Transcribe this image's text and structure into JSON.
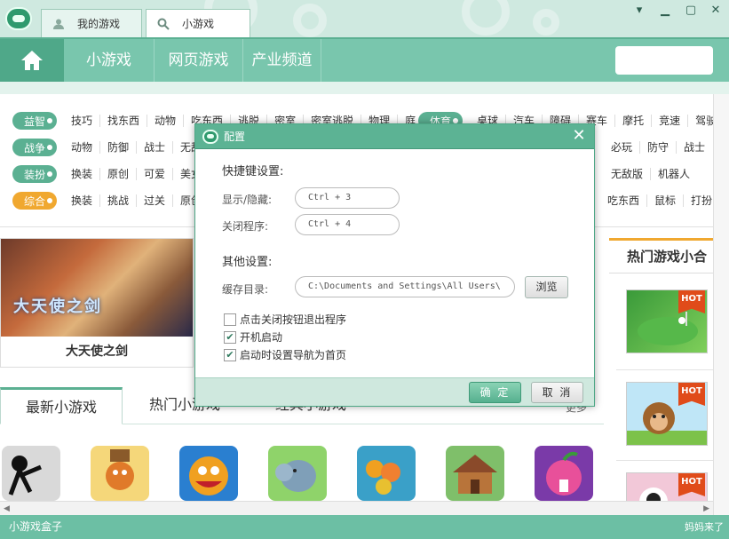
{
  "titlebar": {
    "tabs": [
      {
        "label": "我的游戏",
        "icon": "user-icon"
      },
      {
        "label": "小游戏",
        "icon": "search-icon"
      }
    ],
    "controls": [
      "menu-icon",
      "minimize-icon",
      "maximize-icon",
      "close-icon"
    ]
  },
  "nav": {
    "items": [
      "小游戏",
      "网页游戏",
      "产业频道"
    ]
  },
  "categories": [
    {
      "label": "益智",
      "color": "#5bb092",
      "items": [
        "技巧",
        "找东西",
        "动物",
        "吃东西",
        "逃脱",
        "密室",
        "密室逃脱",
        "物理",
        "庭"
      ]
    },
    {
      "label": "战争",
      "color": "#5bb092",
      "items": [
        "动物",
        "防御",
        "战士",
        "无敌"
      ]
    },
    {
      "label": "装扮",
      "color": "#5bb092",
      "items": [
        "换装",
        "原创",
        "可爱",
        "美女"
      ]
    },
    {
      "label": "综合",
      "color": "#f0a830",
      "items": [
        "换装",
        "挑战",
        "过关",
        "原创"
      ]
    }
  ],
  "categories_right": [
    {
      "label": "体育",
      "color": "#5bb092",
      "items": [
        "桌球",
        "汽车",
        "障碍",
        "赛车",
        "摩托",
        "竞速",
        "驾驶"
      ]
    },
    {
      "label": "",
      "color": "",
      "items": [
        "必玩",
        "防守",
        "战士"
      ]
    },
    {
      "label": "",
      "color": "",
      "items": [
        "无敌版",
        "机器人"
      ]
    },
    {
      "label": "",
      "color": "",
      "items": [
        "吃东西",
        "鼠标",
        "打扮"
      ]
    }
  ],
  "banner": {
    "caption": "大天使之剑",
    "logo": "大天使之剑"
  },
  "sidebar": {
    "title": "热门游戏小合",
    "hot_label": "HOT"
  },
  "tabs": [
    "最新小游戏",
    "热门小游戏",
    "经典小游戏"
  ],
  "more": "更多",
  "statusbar": {
    "text": "小游戏盒子",
    "watermark": "妈妈来了"
  },
  "dialog": {
    "title": "配置",
    "shortcut_title": "快捷键设置:",
    "show_hide_label": "显示/隐藏:",
    "show_hide_value": "Ctrl + 3",
    "close_label": "关闭程序:",
    "close_value": "Ctrl + 4",
    "other_title": "其他设置:",
    "cache_label": "缓存目录:",
    "cache_value": "C:\\Documents and Settings\\All Users\\",
    "browse": "浏览",
    "options": [
      {
        "label": "点击关闭按钮退出程序",
        "checked": false
      },
      {
        "label": "开机启动",
        "checked": true
      },
      {
        "label": "启动时设置导航为首页",
        "checked": true
      }
    ],
    "ok": "确 定",
    "cancel": "取 消"
  }
}
